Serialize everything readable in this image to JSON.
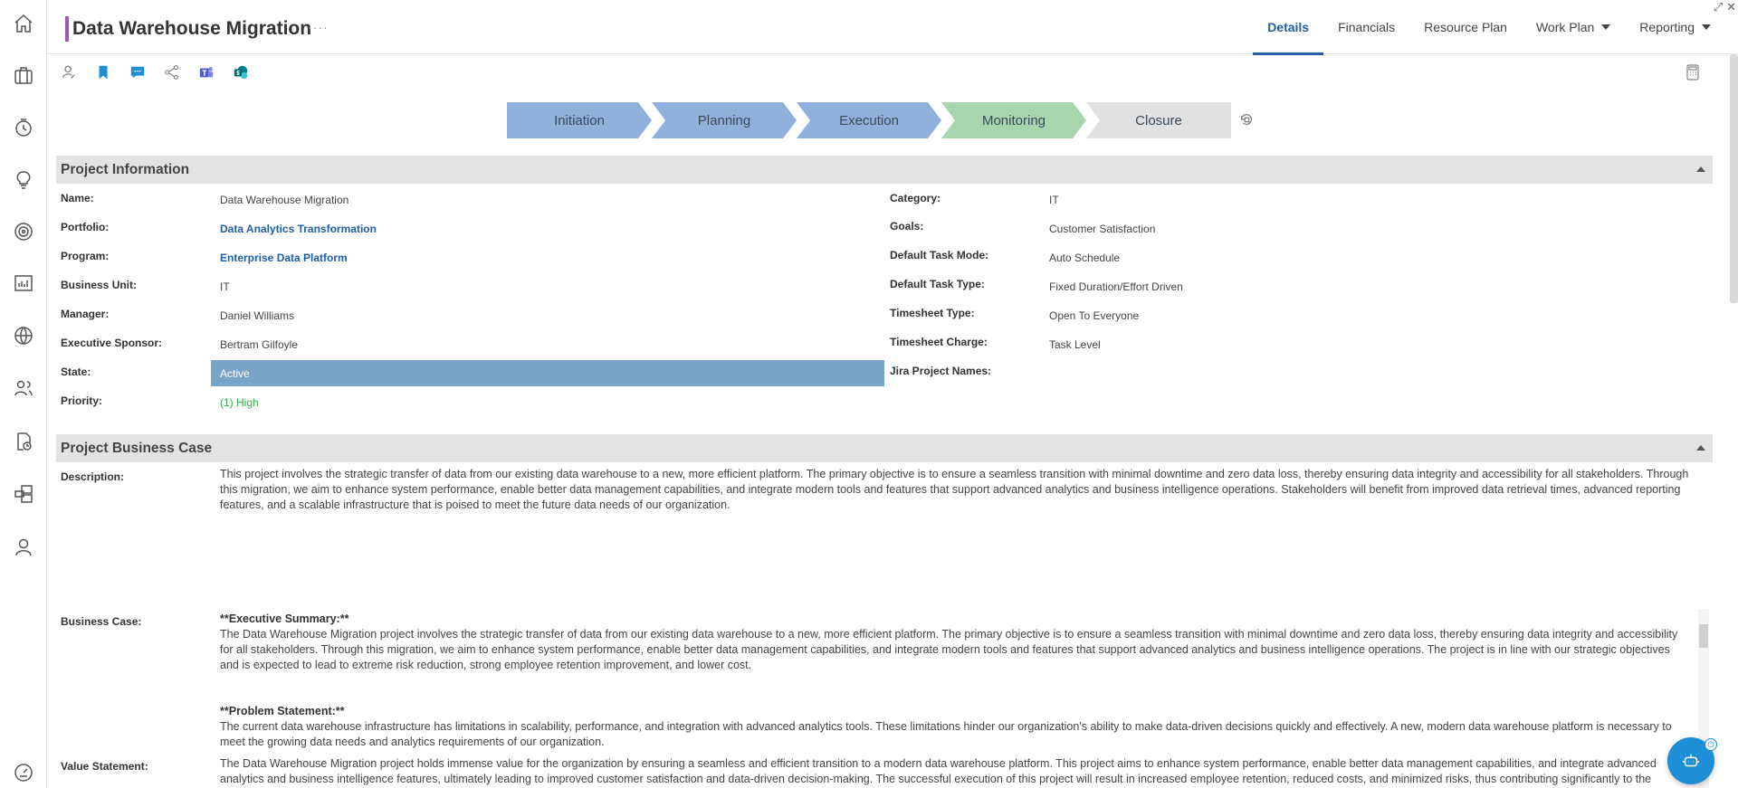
{
  "window": {
    "expand_glyph": "⤢",
    "close_glyph": "✕"
  },
  "header": {
    "title": "Data Warehouse Migration",
    "more": "····",
    "tabs": [
      {
        "label": "Details",
        "active": true
      },
      {
        "label": "Financials"
      },
      {
        "label": "Resource Plan"
      },
      {
        "label": "Work Plan",
        "dropdown": true
      },
      {
        "label": "Reporting",
        "dropdown": true
      }
    ]
  },
  "rail_icons": [
    "home-icon",
    "briefcase-icon",
    "clock-icon",
    "lightbulb-icon",
    "target-icon",
    "dashboard-icon",
    "globe-icon",
    "people-icon",
    "report-icon",
    "stack-icon",
    "user-icon",
    "gauge-icon"
  ],
  "toolbar_icons": [
    "assign-user-icon",
    "bookmark-icon",
    "comment-icon",
    "share-icon",
    "teams-icon",
    "sharepoint-icon"
  ],
  "stages": [
    {
      "label": "Initiation",
      "status": "complete"
    },
    {
      "label": "Planning",
      "status": "complete"
    },
    {
      "label": "Execution",
      "status": "complete"
    },
    {
      "label": "Monitoring",
      "status": "current"
    },
    {
      "label": "Closure",
      "status": "pending"
    }
  ],
  "project_information": {
    "heading": "Project Information",
    "left": [
      {
        "label": "Name:",
        "value": "Data Warehouse Migration"
      },
      {
        "label": "Portfolio:",
        "value": "Data Analytics Transformation"
      },
      {
        "label": "Program:",
        "value": "Enterprise Data Platform"
      },
      {
        "label": "Business Unit:",
        "value": "IT"
      },
      {
        "label": "Manager:",
        "value": "Daniel Williams"
      },
      {
        "label": "Executive Sponsor:",
        "value": "Bertram Gilfoyle"
      },
      {
        "label": "State:",
        "value": "Active"
      },
      {
        "label": "Priority:",
        "value": "(1) High"
      }
    ],
    "right": [
      {
        "label": "Category:",
        "value": "IT"
      },
      {
        "label": "Goals:",
        "value": "Customer Satisfaction"
      },
      {
        "label": "Default Task Mode:",
        "value": "Auto Schedule"
      },
      {
        "label": "Default Task Type:",
        "value": "Fixed Duration/Effort Driven"
      },
      {
        "label": "Timesheet Type:",
        "value": "Open To Everyone"
      },
      {
        "label": "Timesheet Charge:",
        "value": "Task Level"
      },
      {
        "label": "Jira Project Names:",
        "value": ""
      }
    ],
    "state_color": "#79a4c7",
    "priority_color": "#2bb04a"
  },
  "business_case_section": {
    "heading": "Project Business Case",
    "description_label": "Description:",
    "description": "This project involves the strategic transfer of data from our existing data warehouse to a new, more efficient platform. The primary objective is to ensure a seamless transition with minimal downtime and zero data loss, thereby ensuring data integrity and accessibility for all stakeholders. Through this migration, we aim to enhance system performance, enable better data management capabilities, and integrate modern tools and features that support advanced analytics and business intelligence operations. Stakeholders will benefit from improved data retrieval times, advanced reporting features, and a scalable infrastructure that is poised to meet the future data needs of our organization.",
    "business_case_label": "Business Case:",
    "exec_summary_heading": "**Executive Summary:**",
    "exec_summary": "The Data Warehouse Migration project involves the strategic transfer of data from our existing data warehouse to a new, more efficient platform. The primary objective is to ensure a seamless transition with minimal downtime and zero data loss, thereby ensuring data integrity and accessibility for all stakeholders. Through this migration, we aim to enhance system performance, enable better data management capabilities, and integrate modern tools and features that support advanced analytics and business intelligence operations. The project is in line with our strategic objectives and is expected to lead to extreme risk reduction, strong employee retention improvement, and lower cost.",
    "problem_heading": "**Problem Statement:**",
    "problem": "The current data warehouse infrastructure has limitations in scalability, performance, and integration with advanced analytics tools. These limitations hinder our organization's ability to make data-driven decisions quickly and effectively. A new, modern data warehouse platform is necessary to meet the growing data needs and analytics requirements of our organization.",
    "value_label": "Value Statement:",
    "value": "The Data Warehouse Migration project holds immense value for the organization by ensuring a seamless and efficient transition to a modern data warehouse platform. This project aims to enhance system performance, enable better data management capabilities, and integrate advanced analytics and business intelligence features, ultimately leading to improved customer satisfaction and data-driven decision-making. The successful execution of this project will result in increased employee retention, reduced costs, and minimized risks, thus contributing significantly to the"
  },
  "colors": {
    "accent": "#1f5fa8",
    "title_bar": "#9b59b6",
    "stage_blue": "#8fb1dc",
    "stage_green": "#a6d5ae",
    "stage_grey": "#e1e1e1",
    "fab": "#1e8fd6"
  }
}
